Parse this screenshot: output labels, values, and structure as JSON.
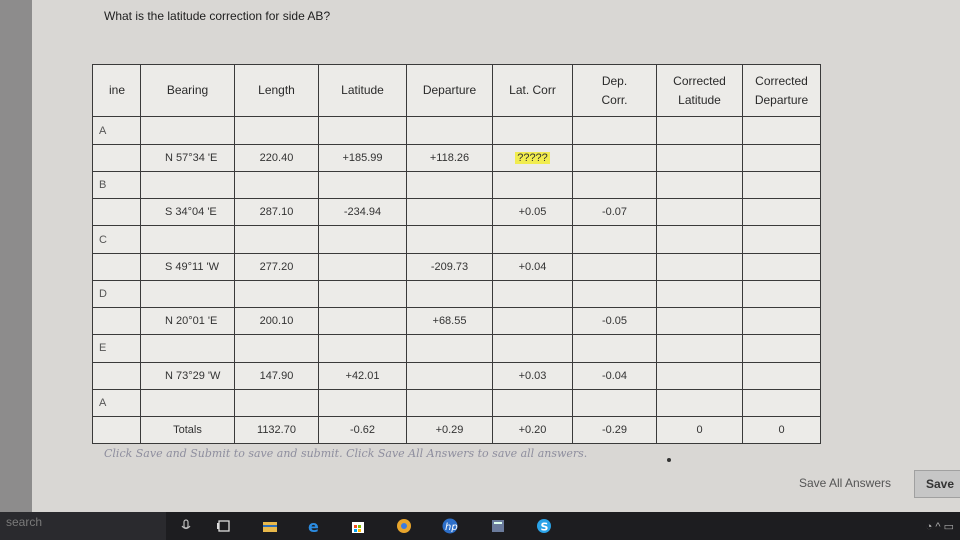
{
  "question": "What is the latitude correction for side AB?",
  "table": {
    "headers": {
      "line": "ine",
      "bearing": "Bearing",
      "length": "Length",
      "latitude": "Latitude",
      "departure": "Departure",
      "lat_corr": "Lat. Corr",
      "dep_corr_1": "Dep.",
      "dep_corr_2": "Corr.",
      "corr_lat_1": "Corrected",
      "corr_lat_2": "Latitude",
      "corr_dep_1": "Corrected",
      "corr_dep_2": "Departure"
    },
    "points": [
      "A",
      "B",
      "C",
      "D",
      "E",
      "A"
    ],
    "rows": [
      {
        "bearing": "N 57°34 'E",
        "length": "220.40",
        "latitude": "+185.99",
        "departure": "+118.26",
        "lat_corr": "?????",
        "dep_corr": "",
        "corr_lat": "",
        "corr_dep": ""
      },
      {
        "bearing": "S 34°04 'E",
        "length": "287.10",
        "latitude": "-234.94",
        "departure": "",
        "lat_corr": "+0.05",
        "dep_corr": "-0.07",
        "corr_lat": "",
        "corr_dep": ""
      },
      {
        "bearing": "S 49°11 'W",
        "length": "277.20",
        "latitude": "",
        "departure": "-209.73",
        "lat_corr": "+0.04",
        "dep_corr": "",
        "corr_lat": "",
        "corr_dep": ""
      },
      {
        "bearing": "N 20°01 'E",
        "length": "200.10",
        "latitude": "",
        "departure": "+68.55",
        "lat_corr": "",
        "dep_corr": "-0.05",
        "corr_lat": "",
        "corr_dep": ""
      },
      {
        "bearing": "N 73°29 'W",
        "length": "147.90",
        "latitude": "+42.01",
        "departure": "",
        "lat_corr": "+0.03",
        "dep_corr": "-0.04",
        "corr_lat": "",
        "corr_dep": ""
      }
    ],
    "totals": {
      "label": "Totals",
      "length": "1132.70",
      "latitude": "-0.62",
      "departure": "+0.29",
      "lat_corr": "+0.20",
      "dep_corr": "-0.29",
      "corr_lat": "0",
      "corr_dep": "0"
    }
  },
  "note": "Click Save and Submit to save and submit. Click Save All Answers to save all answers.",
  "buttons": {
    "save_all": "Save All Answers",
    "save": "Save"
  },
  "taskbar": {
    "search_placeholder": "search",
    "icons": [
      "microphone-icon",
      "task-view-icon",
      "file-explorer-icon",
      "edge-icon",
      "store-icon",
      "chrome-icon",
      "hp-icon",
      "calculator-icon",
      "skype-icon"
    ]
  },
  "colors": {
    "highlight": "#f1ec4f",
    "table_border": "#3a3a3a",
    "page_bg": "#d9d7d4"
  }
}
